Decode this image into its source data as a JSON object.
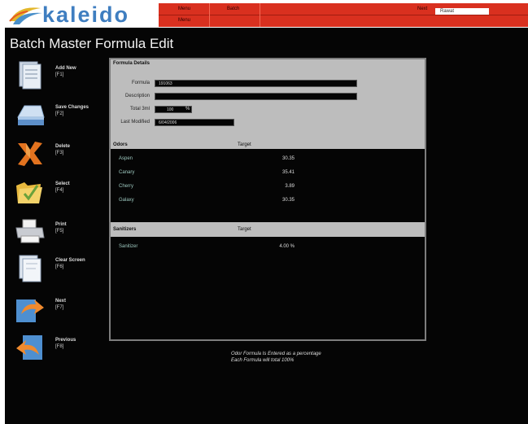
{
  "app": {
    "logo_text": "kaleido",
    "page_title": "Batch Master Formula Edit"
  },
  "topbar": {
    "items": [
      "Menu",
      "Batch",
      "Next"
    ],
    "row2_item": "Menu",
    "field_value": "Rawat"
  },
  "sidebar": {
    "items": [
      {
        "label": "Add New",
        "key": "[F1]",
        "icon": "document-stack-icon"
      },
      {
        "label": "Save Changes",
        "key": "[F2]",
        "icon": "save-disk-icon"
      },
      {
        "label": "Delete",
        "key": "[F3]",
        "icon": "delete-x-icon"
      },
      {
        "label": "Select",
        "key": "[F4]",
        "icon": "folder-check-icon"
      },
      {
        "label": "Print",
        "key": "[F5]",
        "icon": "printer-icon"
      },
      {
        "label": "Clear Screen",
        "key": "[F6]",
        "icon": "clear-screen-icon"
      },
      {
        "label": "Next",
        "key": "[F7]",
        "icon": "next-arrow-icon"
      },
      {
        "label": "Previous",
        "key": "[F8]",
        "icon": "previous-arrow-icon"
      }
    ]
  },
  "formula_details": {
    "title": "Formula Details",
    "formula_label": "Formula",
    "formula_value": "191063",
    "description_label": "Description",
    "description_value": "",
    "total_label": "Total 3ml",
    "total_value": "100",
    "total_unit": "%",
    "modified_label": "Last Modified",
    "modified_value": "6/04/2006"
  },
  "odors": {
    "header": "Odors",
    "col_header": "Target",
    "rows": [
      {
        "name": "Aspen",
        "value": "30.35"
      },
      {
        "name": "Canary",
        "value": "35.41"
      },
      {
        "name": "Cherry",
        "value": "3.89"
      },
      {
        "name": "Galaxy",
        "value": "30.35"
      }
    ]
  },
  "sanitizers": {
    "header": "Sanitizers",
    "col_header": "Target",
    "rows": [
      {
        "name": "Sanitizer",
        "value": "4.00 %"
      }
    ]
  },
  "note": {
    "line1": "Odor Formula Is Entered as a percentage",
    "line2": "Each Formula will total 100%"
  },
  "colors": {
    "topbar": "#d9301f",
    "background": "#050505",
    "panel_header": "#bdbdbd"
  }
}
